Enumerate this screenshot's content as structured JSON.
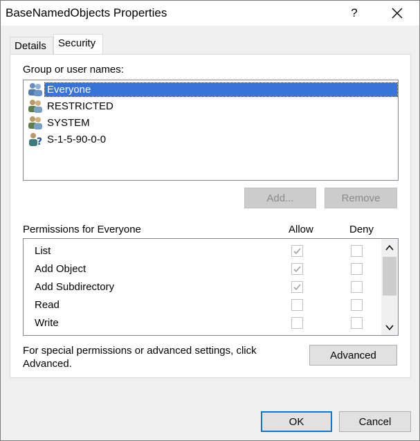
{
  "window": {
    "title": "BaseNamedObjects Properties",
    "help_label": "?"
  },
  "tabs": [
    {
      "label": "Details"
    },
    {
      "label": "Security"
    }
  ],
  "security": {
    "group_label": "Group or user names:",
    "users": [
      {
        "name": "Everyone",
        "icon": "users-group-icon",
        "selected": true
      },
      {
        "name": "RESTRICTED",
        "icon": "users-group-icon",
        "selected": false
      },
      {
        "name": "SYSTEM",
        "icon": "users-group-icon",
        "selected": false
      },
      {
        "name": "S-1-5-90-0-0",
        "icon": "unknown-user-icon",
        "selected": false
      }
    ],
    "add_label": "Add...",
    "remove_label": "Remove",
    "permissions_label": "Permissions for Everyone",
    "allow_header": "Allow",
    "deny_header": "Deny",
    "permissions": [
      {
        "name": "List",
        "allow": true,
        "deny": false
      },
      {
        "name": "Add Object",
        "allow": true,
        "deny": false
      },
      {
        "name": "Add Subdirectory",
        "allow": true,
        "deny": false
      },
      {
        "name": "Read",
        "allow": false,
        "deny": false
      },
      {
        "name": "Write",
        "allow": false,
        "deny": false
      }
    ],
    "advanced_text": "For special permissions or advanced settings, click Advanced.",
    "advanced_label": "Advanced"
  },
  "footer": {
    "ok_label": "OK",
    "cancel_label": "Cancel"
  },
  "colors": {
    "selection": "#3874d8",
    "focus_border": "#0078d7"
  }
}
